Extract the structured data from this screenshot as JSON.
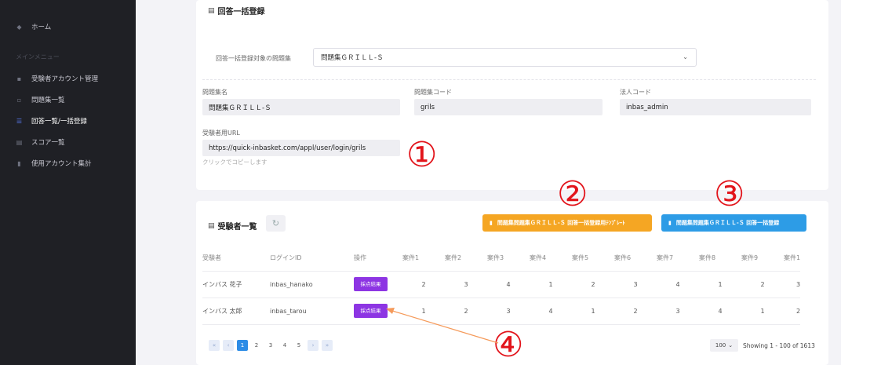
{
  "sidebar": {
    "home": "ホーム",
    "menu_heading": "メインメニュー",
    "items": [
      {
        "label": "受験者アカウント管理",
        "icon": "user-icon"
      },
      {
        "label": "問題集一覧",
        "icon": "grid-icon"
      },
      {
        "label": "回答一覧/一括登録",
        "icon": "list-icon",
        "active": true
      },
      {
        "label": "スコア一覧",
        "icon": "chart-icon"
      },
      {
        "label": "使用アカウント集計",
        "icon": "document-icon"
      }
    ]
  },
  "bulk": {
    "title": "回答一括登録",
    "target_label": "回答一括登録対象の問題集",
    "target_value": "問題集ＧＲＩＬＬ-Ｓ",
    "fields": {
      "name_label": "問題集名",
      "name_value": "問題集ＧＲＩＬＬ-Ｓ",
      "code_label": "問題集コード",
      "code_value": "grils",
      "corp_label": "法人コード",
      "corp_value": "inbas_admin",
      "url_label": "受験者用URL",
      "url_value": "https://quick-inbasket.com/appl/user/login/grils",
      "copy_hint": "クリックでコピーします"
    }
  },
  "examinees": {
    "title": "受験者一覧",
    "template_button": "問題集問題集ＧＲＩＬＬ-Ｓ 回答一括登録用ﾃﾝﾌﾟﾚｰﾄ",
    "register_button": "問題集問題集ＧＲＩＬＬ-Ｓ 回答一括登録",
    "columns": [
      "受験者",
      "ログインID",
      "操作",
      "案件1",
      "案件2",
      "案件3",
      "案件4",
      "案件5",
      "案件6",
      "案件7",
      "案件8",
      "案件9",
      "案件1"
    ],
    "rows": [
      {
        "name": "インバス 花子",
        "login": "inbas_hanako",
        "action": "採点結果",
        "scores": [
          "2",
          "3",
          "4",
          "1",
          "2",
          "3",
          "4",
          "1",
          "2",
          "3"
        ]
      },
      {
        "name": "インバス 太郎",
        "login": "inbas_tarou",
        "action": "採点結果",
        "scores": [
          "1",
          "2",
          "3",
          "4",
          "1",
          "2",
          "3",
          "4",
          "1",
          "2"
        ]
      }
    ],
    "pagination": {
      "first": "«",
      "prev": "‹",
      "pages": [
        "1",
        "2",
        "3",
        "4",
        "5"
      ],
      "next": "›",
      "last": "»",
      "per_page": "100",
      "showing": "Showing 1 - 100 of 1613"
    }
  },
  "annotations": [
    "①",
    "②",
    "③",
    "④"
  ],
  "colors": {
    "sidebar": "#1f2025",
    "orange": "#f5a623",
    "blue": "#2d9ce6",
    "purple": "#8d35e3",
    "annotation_red": "#e2141b"
  }
}
